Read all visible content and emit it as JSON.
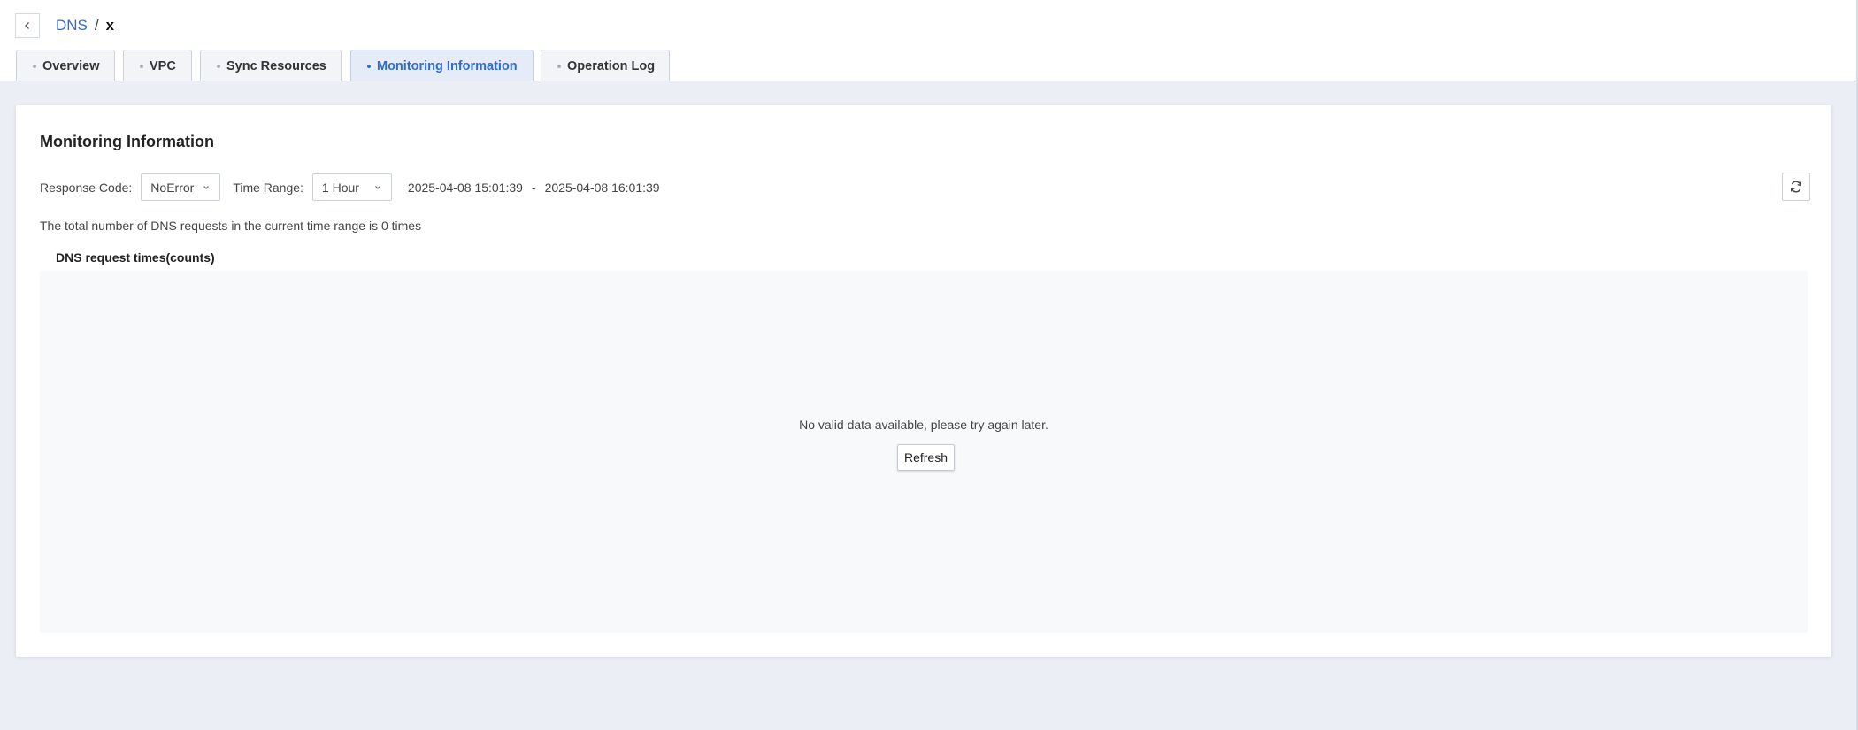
{
  "breadcrumb": {
    "back_icon": "chevron-left-icon",
    "parent": "DNS",
    "separator": "/",
    "current": "x"
  },
  "tabs": [
    {
      "label": "Overview",
      "active": false
    },
    {
      "label": "VPC",
      "active": false
    },
    {
      "label": "Sync Resources",
      "active": false
    },
    {
      "label": "Monitoring Information",
      "active": true
    },
    {
      "label": "Operation Log",
      "active": false
    }
  ],
  "monitoring": {
    "title": "Monitoring Information",
    "response_code_label": "Response Code:",
    "response_code_value": "NoError",
    "time_range_label": "Time Range:",
    "time_range_value": "1 Hour",
    "start_time": "2025-04-08 15:01:39",
    "range_separator": "-",
    "end_time": "2025-04-08 16:01:39",
    "refresh_icon": "refresh-icon",
    "summary": "The total number of DNS requests in the current time range is 0 times"
  },
  "chart": {
    "title": "DNS request times(counts)",
    "empty_message": "No valid data available, please try again later.",
    "refresh_label": "Refresh"
  },
  "colors": {
    "accent": "#2f6bd8",
    "page_bg": "#ebeef5",
    "chart_bg": "#f8f9fb"
  }
}
